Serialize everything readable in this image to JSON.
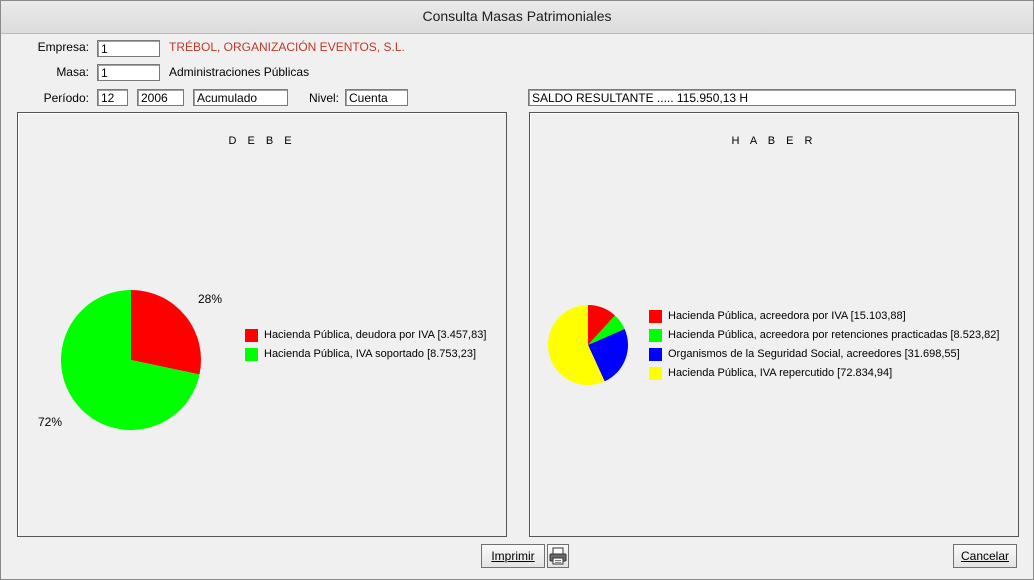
{
  "window": {
    "title": "Consulta Masas Patrimoniales"
  },
  "form": {
    "empresa": {
      "label": "Empresa:",
      "value": "1",
      "name": "TRÉBOL, ORGANIZACIÓN EVENTOS, S.L.",
      "name_color": "#c0392b"
    },
    "masa": {
      "label": "Masa:",
      "value": "1",
      "name": "Administraciones Públicas"
    },
    "periodo": {
      "label": "Período:",
      "month": "12",
      "year": "2006",
      "mode": "Acumulado"
    },
    "nivel": {
      "label": "Nivel:",
      "value": "Cuenta"
    },
    "saldo": {
      "value": "SALDO RESULTANTE ..... 115.950,13 H"
    }
  },
  "debe": {
    "title": "D E B E",
    "chart_data": {
      "type": "pie",
      "slices": [
        {
          "label": "Hacienda Pública, deudora por IVA [3.457,83]",
          "value": 3457.83,
          "percent_label": "28%",
          "color": "#ff0000"
        },
        {
          "label": "Hacienda Pública, IVA soportado [8.753,23]",
          "value": 8753.23,
          "percent_label": "72%",
          "color": "#00ff00"
        }
      ]
    }
  },
  "haber": {
    "title": "H A B E R",
    "chart_data": {
      "type": "pie",
      "slices": [
        {
          "label": "Hacienda Pública, acreedora por IVA [15.103,88]",
          "value": 15103.88,
          "color": "#ff0000"
        },
        {
          "label": "Hacienda Pública, acreedora por retenciones practicadas [8.523,82]",
          "value": 8523.82,
          "color": "#00ff00"
        },
        {
          "label": "Organismos de la Seguridad Social, acreedores [31.698,55]",
          "value": 31698.55,
          "color": "#0000ff"
        },
        {
          "label": "Hacienda Pública, IVA repercutido [72.834,94]",
          "value": 72834.94,
          "color": "#ffff00"
        }
      ]
    }
  },
  "buttons": {
    "print": "Imprimir",
    "print_icon": "printer-icon",
    "cancel": "Cancelar"
  }
}
